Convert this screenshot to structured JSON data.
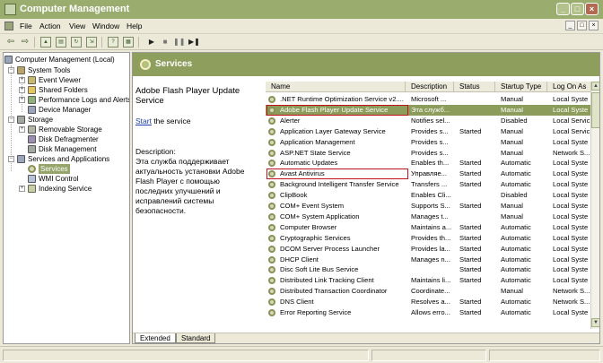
{
  "window": {
    "title": "Computer Management",
    "controls": [
      "_",
      "□",
      "×"
    ]
  },
  "menu": {
    "items": [
      "File",
      "Action",
      "View",
      "Window",
      "Help"
    ],
    "mdi_controls": [
      "_",
      "□",
      "×"
    ]
  },
  "toolbar": {
    "buttons": [
      "back-icon",
      "forward-icon",
      "up-folder-icon",
      "properties-icon",
      "refresh-icon",
      "export-icon",
      "help-icon",
      "play-icon",
      "stop-icon",
      "pause-icon",
      "restart-icon"
    ]
  },
  "tree": {
    "root": "Computer Management (Local)",
    "system_tools": "System Tools",
    "event_viewer": "Event Viewer",
    "shared_folders": "Shared Folders",
    "perf_logs": "Performance Logs and Alerts",
    "device_manager": "Device Manager",
    "storage": "Storage",
    "removable_storage": "Removable Storage",
    "disk_defrag": "Disk Defragmenter",
    "disk_mgmt": "Disk Management",
    "services_apps": "Services and Applications",
    "services": "Services",
    "wmi": "WMI Control",
    "indexing": "Indexing Service"
  },
  "pane": {
    "header": "Services",
    "desc_title": "Adobe Flash Player Update Service",
    "start_link": "Start",
    "start_suffix": " the service",
    "desc_label": "Description:",
    "desc_text": "Эта служба поддерживает актуальность установки Adobe Flash Player с помощью последних улучшений и исправлений системы безопасности."
  },
  "columns": [
    "Name",
    "Description",
    "Status",
    "Startup Type",
    "Log On As"
  ],
  "services": [
    {
      "name": ".NET Runtime Optimization Service v2....",
      "desc": "Microsoft ...",
      "status": "",
      "startup": "Manual",
      "logon": "Local Syste"
    },
    {
      "name": "Adobe Flash Player Update Service",
      "desc": "Эта служб...",
      "status": "",
      "startup": "Manual",
      "logon": "Local Syste"
    },
    {
      "name": "Alerter",
      "desc": "Notifies sel...",
      "status": "",
      "startup": "Disabled",
      "logon": "Local Servic"
    },
    {
      "name": "Application Layer Gateway Service",
      "desc": "Provides s...",
      "status": "Started",
      "startup": "Manual",
      "logon": "Local Servic"
    },
    {
      "name": "Application Management",
      "desc": "Provides s...",
      "status": "",
      "startup": "Manual",
      "logon": "Local Syste"
    },
    {
      "name": "ASP.NET State Service",
      "desc": "Provides s...",
      "status": "",
      "startup": "Manual",
      "logon": "Network S..."
    },
    {
      "name": "Automatic Updates",
      "desc": "Enables th...",
      "status": "Started",
      "startup": "Automatic",
      "logon": "Local Syste"
    },
    {
      "name": "Avast Antivirus",
      "desc": "Управляе...",
      "status": "Started",
      "startup": "Automatic",
      "logon": "Local Syste"
    },
    {
      "name": "Background Intelligent Transfer Service",
      "desc": "Transfers ...",
      "status": "Started",
      "startup": "Automatic",
      "logon": "Local Syste"
    },
    {
      "name": "ClipBook",
      "desc": "Enables Cli...",
      "status": "",
      "startup": "Disabled",
      "logon": "Local Syste"
    },
    {
      "name": "COM+ Event System",
      "desc": "Supports S...",
      "status": "Started",
      "startup": "Manual",
      "logon": "Local Syste"
    },
    {
      "name": "COM+ System Application",
      "desc": "Manages t...",
      "status": "",
      "startup": "Manual",
      "logon": "Local Syste"
    },
    {
      "name": "Computer Browser",
      "desc": "Maintains a...",
      "status": "Started",
      "startup": "Automatic",
      "logon": "Local Syste"
    },
    {
      "name": "Cryptographic Services",
      "desc": "Provides th...",
      "status": "Started",
      "startup": "Automatic",
      "logon": "Local Syste"
    },
    {
      "name": "DCOM Server Process Launcher",
      "desc": "Provides la...",
      "status": "Started",
      "startup": "Automatic",
      "logon": "Local Syste"
    },
    {
      "name": "DHCP Client",
      "desc": "Manages n...",
      "status": "Started",
      "startup": "Automatic",
      "logon": "Local Syste"
    },
    {
      "name": "Disc Soft Lite Bus Service",
      "desc": "",
      "status": "Started",
      "startup": "Automatic",
      "logon": "Local Syste"
    },
    {
      "name": "Distributed Link Tracking Client",
      "desc": "Maintains li...",
      "status": "Started",
      "startup": "Automatic",
      "logon": "Local Syste"
    },
    {
      "name": "Distributed Transaction Coordinator",
      "desc": "Coordinate...",
      "status": "",
      "startup": "Manual",
      "logon": "Network S..."
    },
    {
      "name": "DNS Client",
      "desc": "Resolves a...",
      "status": "Started",
      "startup": "Automatic",
      "logon": "Network S..."
    },
    {
      "name": "Error Reporting Service",
      "desc": "Allows erro...",
      "status": "Started",
      "startup": "Automatic",
      "logon": "Local Syste"
    }
  ],
  "tabs": [
    "Extended",
    "Standard"
  ],
  "colors": {
    "accent": "#8c9c5a",
    "highlight": "#c0121b"
  }
}
